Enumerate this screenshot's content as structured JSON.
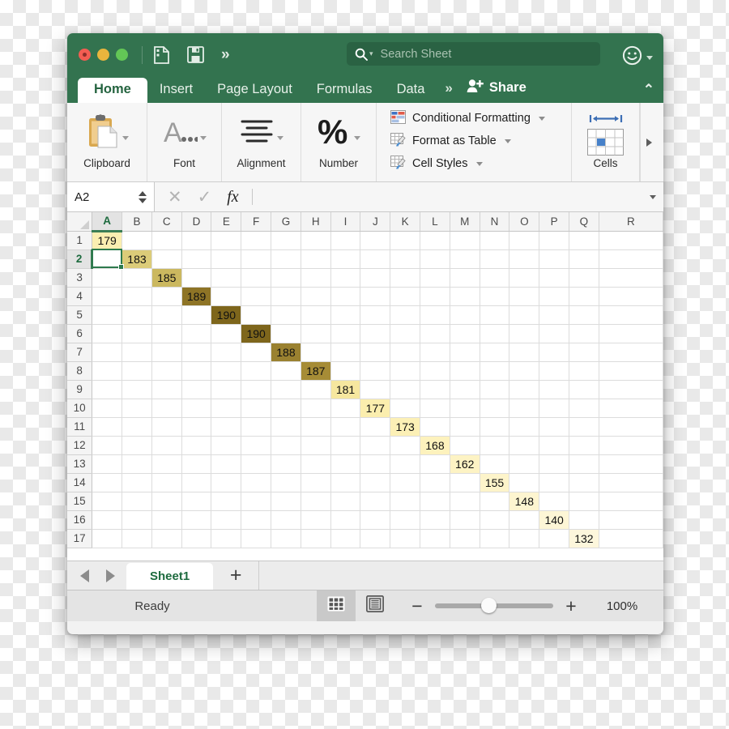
{
  "window": {
    "traffic_lights": [
      "close",
      "minimize",
      "maximize"
    ],
    "quick_access": [
      "new-from-template-icon",
      "save-icon",
      "more-chevron-icon"
    ],
    "more_glyph": "»",
    "collapse_glyph": "⌃"
  },
  "search": {
    "placeholder": "Search Sheet",
    "value": "",
    "icon": "search-icon"
  },
  "account": {
    "icon": "smiley-face-icon"
  },
  "tabs": [
    {
      "label": "Home",
      "active": true
    },
    {
      "label": "Insert",
      "active": false
    },
    {
      "label": "Page Layout",
      "active": false
    },
    {
      "label": "Formulas",
      "active": false
    },
    {
      "label": "Data",
      "active": false
    }
  ],
  "share": {
    "label": "Share",
    "icon": "add-person-icon"
  },
  "ribbon": {
    "groups": [
      {
        "label": "Clipboard",
        "icon": "clipboard-icon"
      },
      {
        "label": "Font",
        "icon": "font-A-icon"
      },
      {
        "label": "Alignment",
        "icon": "alignment-lines-icon"
      },
      {
        "label": "Number",
        "icon": "percent-icon"
      },
      {
        "label": "Cells",
        "icon": "cells-grid-icon"
      }
    ],
    "styles": [
      {
        "label": "Conditional Formatting",
        "icon": "conditional-formatting-icon"
      },
      {
        "label": "Format as Table",
        "icon": "format-as-table-icon"
      },
      {
        "label": "Cell Styles",
        "icon": "cell-styles-icon"
      }
    ]
  },
  "formula_bar": {
    "name_box": "A2",
    "formula": "",
    "cancel_glyph": "✕",
    "confirm_glyph": "✓",
    "fx_label": "fx"
  },
  "grid": {
    "columns": [
      "A",
      "B",
      "C",
      "D",
      "E",
      "F",
      "G",
      "H",
      "I",
      "J",
      "K",
      "L",
      "M",
      "N",
      "O",
      "P",
      "Q",
      "R"
    ],
    "rows": [
      1,
      2,
      3,
      4,
      5,
      6,
      7,
      8,
      9,
      10,
      11,
      12,
      13,
      14,
      15,
      16,
      17
    ],
    "selected_cell": "A2",
    "selected_column": "A",
    "selected_row": 2,
    "diagonal_values": [
      {
        "cell": "A1",
        "col": 0,
        "row": 1,
        "value": "179",
        "bg": "#faeeb1"
      },
      {
        "cell": "B2",
        "col": 1,
        "row": 2,
        "value": "183",
        "bg": "#dccc79"
      },
      {
        "cell": "C3",
        "col": 2,
        "row": 3,
        "value": "185",
        "bg": "#cbb85f"
      },
      {
        "cell": "D4",
        "col": 3,
        "row": 4,
        "value": "189",
        "bg": "#8e7426"
      },
      {
        "cell": "E5",
        "col": 4,
        "row": 5,
        "value": "190",
        "bg": "#7e661c"
      },
      {
        "cell": "F6",
        "col": 5,
        "row": 6,
        "value": "190",
        "bg": "#7e661c"
      },
      {
        "cell": "G7",
        "col": 6,
        "row": 7,
        "value": "188",
        "bg": "#9a8130"
      },
      {
        "cell": "H8",
        "col": 7,
        "row": 8,
        "value": "187",
        "bg": "#a68c36"
      },
      {
        "cell": "I9",
        "col": 8,
        "row": 9,
        "value": "181",
        "bg": "#f6e79f"
      },
      {
        "cell": "J10",
        "col": 9,
        "row": 10,
        "value": "177",
        "bg": "#fbeeae"
      },
      {
        "cell": "K11",
        "col": 10,
        "row": 11,
        "value": "173",
        "bg": "#fcf0b6"
      },
      {
        "cell": "L12",
        "col": 11,
        "row": 12,
        "value": "168",
        "bg": "#fdf2bd"
      },
      {
        "cell": "M13",
        "col": 12,
        "row": 13,
        "value": "162",
        "bg": "#fdf3c4"
      },
      {
        "cell": "N14",
        "col": 13,
        "row": 14,
        "value": "155",
        "bg": "#fdf4ca"
      },
      {
        "cell": "O15",
        "col": 14,
        "row": 15,
        "value": "148",
        "bg": "#fdf5d0"
      },
      {
        "cell": "P16",
        "col": 15,
        "row": 16,
        "value": "140",
        "bg": "#fdf6d6"
      },
      {
        "cell": "Q17",
        "col": 16,
        "row": 17,
        "value": "132",
        "bg": "#fdf7dc"
      }
    ]
  },
  "sheet_tabs": {
    "prev_glyph": "◀",
    "next_glyph": "▶",
    "sheets": [
      {
        "name": "Sheet1",
        "active": true
      }
    ],
    "add_glyph": "+"
  },
  "status": {
    "text": "Ready",
    "views": [
      {
        "name": "normal-view",
        "icon": "grid-view-icon",
        "active": true
      },
      {
        "name": "page-layout-view",
        "icon": "page-view-icon",
        "active": false
      }
    ],
    "zoom_minus": "−",
    "zoom_plus": "+",
    "zoom_level": "100%"
  },
  "colors": {
    "brand_green": "#33734f",
    "tab_active_text": "#256440",
    "selection_green": "#2d7a4d"
  }
}
